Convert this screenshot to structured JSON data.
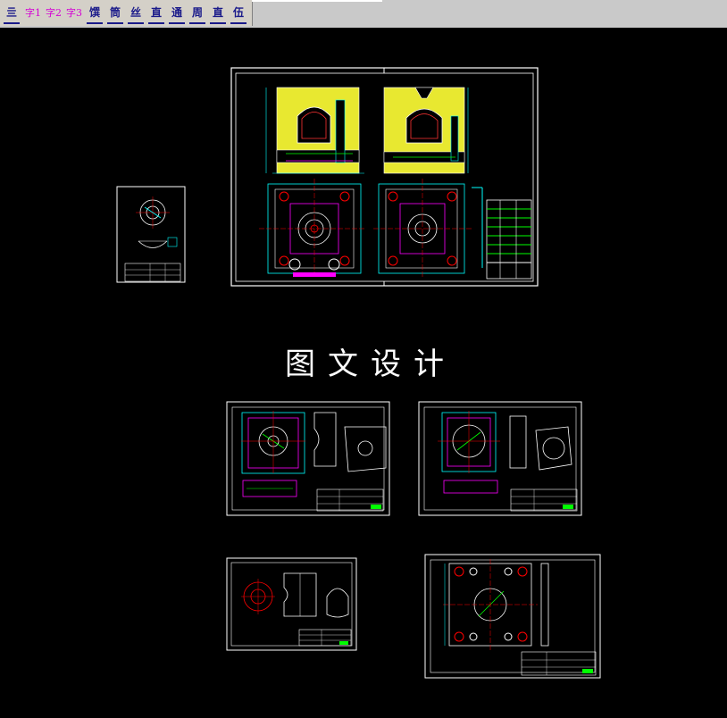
{
  "toolbar": {
    "items": [
      {
        "label": "亖",
        "kind": "icon"
      },
      {
        "label": "字1",
        "kind": "text-style"
      },
      {
        "label": "字2",
        "kind": "text-style"
      },
      {
        "label": "字3",
        "kind": "text-style"
      },
      {
        "label": "馔",
        "kind": "icon"
      },
      {
        "label": "筒",
        "kind": "icon"
      },
      {
        "label": "丝",
        "kind": "icon"
      },
      {
        "label": "直",
        "kind": "icon"
      },
      {
        "label": "通",
        "kind": "icon"
      },
      {
        "label": "周",
        "kind": "icon"
      },
      {
        "label": "直",
        "kind": "icon"
      },
      {
        "label": "伍",
        "kind": "icon"
      }
    ]
  },
  "canvas": {
    "background": "#000000",
    "center_text": "图文设计"
  },
  "colors": {
    "line": "#ffffff",
    "accent_cyan": "#00ffff",
    "accent_magenta": "#ff00ff",
    "accent_red": "#ff0000",
    "accent_green": "#00ff00",
    "accent_yellow": "#ffff33"
  }
}
